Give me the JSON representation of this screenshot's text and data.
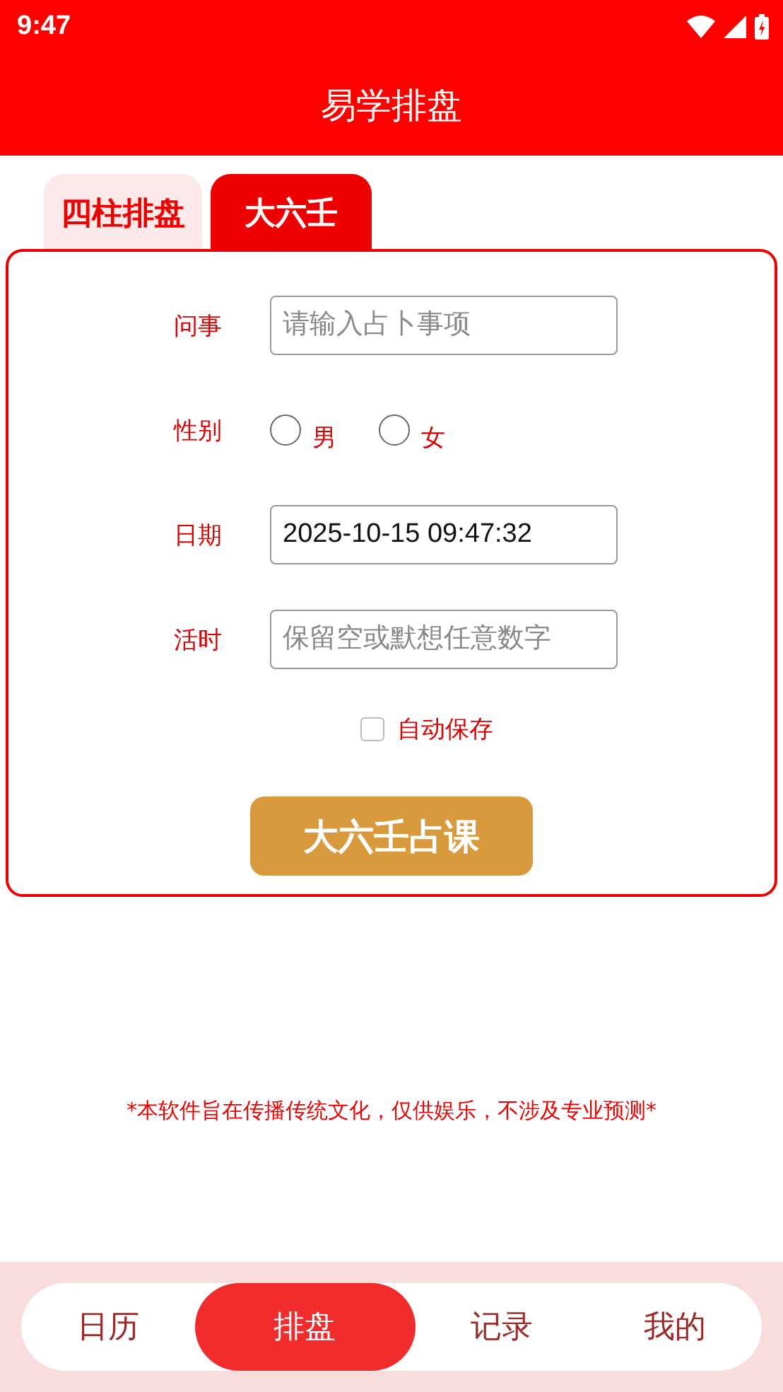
{
  "status_bar": {
    "time": "9:47"
  },
  "app_bar": {
    "title": "易学排盘"
  },
  "tabs": [
    {
      "label": "四柱排盘",
      "selected": false
    },
    {
      "label": "大六壬",
      "selected": true
    }
  ],
  "form": {
    "fields": [
      {
        "kind": "text",
        "label": "问事",
        "placeholder": "请输入占卜事项"
      },
      {
        "kind": "radio",
        "label": "性别",
        "options": [
          {
            "label": "男",
            "selected": false
          },
          {
            "label": "女",
            "selected": false
          }
        ]
      },
      {
        "kind": "text",
        "label": "日期",
        "value": "2025-10-15 09:47:32"
      },
      {
        "kind": "text",
        "label": "活时",
        "placeholder": "保留空或默想任意数字"
      }
    ],
    "auto_save": {
      "label": "自动保存",
      "checked": false
    },
    "submit": "大六壬占课"
  },
  "disclaimer": "*本软件旨在传播传统文化，仅供娱乐，不涉及专业预测*",
  "bottom_nav": [
    {
      "label": "日历",
      "selected": false
    },
    {
      "label": "排盘",
      "selected": true
    },
    {
      "label": "记录",
      "selected": false
    },
    {
      "label": "我的",
      "selected": false
    }
  ]
}
